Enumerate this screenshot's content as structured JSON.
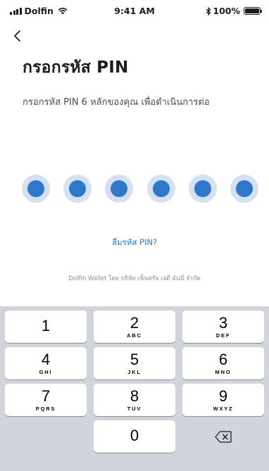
{
  "status_bar": {
    "carrier": "Dolfin",
    "time": "9:41 AM",
    "battery": "100%",
    "icons": [
      "signal-icon",
      "wifi-icon",
      "bluetooth-icon",
      "battery-icon"
    ]
  },
  "header": {
    "back_icon": "chevron-left-icon",
    "title": "กรอกรหัส PIN",
    "subtitle": "กรอกรหัส PIN 6 หลักของคุณ เพื่อดำเนินการต่อ"
  },
  "pin": {
    "length": 6,
    "filled": 6,
    "accent_color": "#2f77c9",
    "ring_color": "#d3e1f3"
  },
  "forgot_link": "ลืมรหัส PIN?",
  "footer_note": "Dolfin Wallet โดย บริษัท เซ็นทรัล เจดี มันนี่ จำกัด",
  "keypad": {
    "keys": [
      {
        "num": "1",
        "letters": ""
      },
      {
        "num": "2",
        "letters": "ABC"
      },
      {
        "num": "3",
        "letters": "DEF"
      },
      {
        "num": "4",
        "letters": "GHI"
      },
      {
        "num": "5",
        "letters": "JKL"
      },
      {
        "num": "6",
        "letters": "MNO"
      },
      {
        "num": "7",
        "letters": "PQRS"
      },
      {
        "num": "8",
        "letters": "TUV"
      },
      {
        "num": "9",
        "letters": "WXYZ"
      },
      {
        "num": "0",
        "letters": ""
      }
    ],
    "delete_icon": "backspace-icon"
  }
}
